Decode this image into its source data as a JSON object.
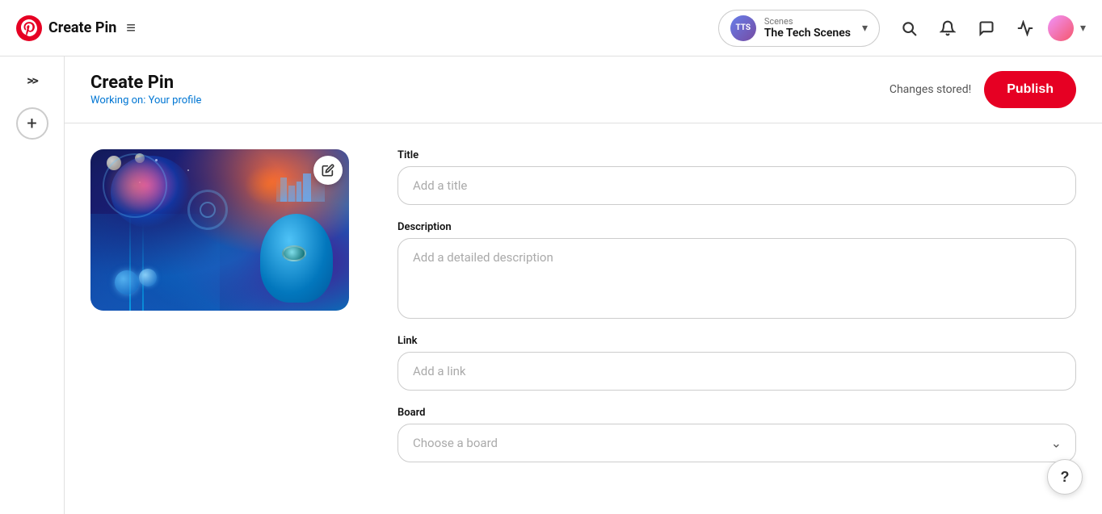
{
  "app": {
    "logo_label": "Pinterest",
    "nav_title": "Create Pin",
    "hamburger": "≡"
  },
  "board_selector": {
    "label": "Scenes",
    "name": "The Tech Scenes",
    "avatar_text": "TTS"
  },
  "nav_icons": {
    "search": "🔍",
    "bell": "🔔",
    "chat": "💬",
    "announce": "📣",
    "user": ""
  },
  "header": {
    "title": "Create Pin",
    "subtitle": "Working on: Your profile",
    "changes_stored": "Changes stored!",
    "publish_label": "Publish"
  },
  "sidebar": {
    "arrows_label": ">>",
    "plus_label": "+"
  },
  "form": {
    "title_label": "Title",
    "title_placeholder": "Add a title",
    "description_label": "Description",
    "description_placeholder": "Add a detailed description",
    "link_label": "Link",
    "link_placeholder": "Add a link",
    "board_label": "Board",
    "board_placeholder": "Choose a board"
  },
  "help": {
    "label": "?"
  }
}
